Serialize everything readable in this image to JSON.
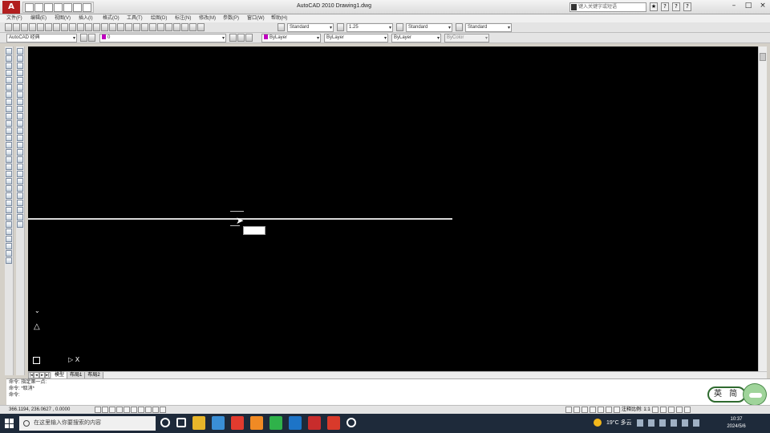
{
  "window": {
    "app_logo": "A",
    "title": "AutoCAD 2010   Drawing1.dwg",
    "search_placeholder": "键入关键字或短语",
    "min_glyph": "–",
    "max_glyph": "□",
    "close_glyph": "×"
  },
  "title_icons": [
    "★",
    "?",
    "?",
    "?"
  ],
  "menu": [
    "文件(F)",
    "编辑(E)",
    "视图(V)",
    "插入(I)",
    "格式(O)",
    "工具(T)",
    "绘图(D)",
    "标注(N)",
    "修改(M)",
    "参数(P)",
    "窗口(W)",
    "帮助(H)"
  ],
  "toolbar": {
    "text_style": "Standard",
    "dim_scale": "1.25",
    "table_style": "Standard",
    "multileader_style": "Standard",
    "workspace": "AutoCAD 经典",
    "layer": "0",
    "color": "ByLayer",
    "linetype": "ByLayer",
    "lineweight": "ByLayer",
    "plot_style": "ByColor"
  },
  "layout_tabs": {
    "nav": [
      "|◂",
      "◂",
      "▸",
      "▸|"
    ],
    "items": [
      "模型",
      "布局1",
      "布局2"
    ]
  },
  "command": {
    "line1": "命令:  指定第一点:",
    "line2": "命令:  *取消*",
    "prompt": "命令:"
  },
  "status": {
    "coords": "366.1194, 236.0627 , 0.0000",
    "annotation_label": "注释比例: 1:1"
  },
  "ime": {
    "label": "英 简"
  },
  "taskbar": {
    "search_placeholder": "在这里输入你要搜索的内容",
    "weather": "19°C 多云",
    "time": "10:37",
    "date": "2024/5/6"
  },
  "colors": {
    "canvas": "#000000",
    "logo": "#b21f1f",
    "taskbar": "#1e2a3a",
    "layer_swatch": "#c000c0"
  }
}
